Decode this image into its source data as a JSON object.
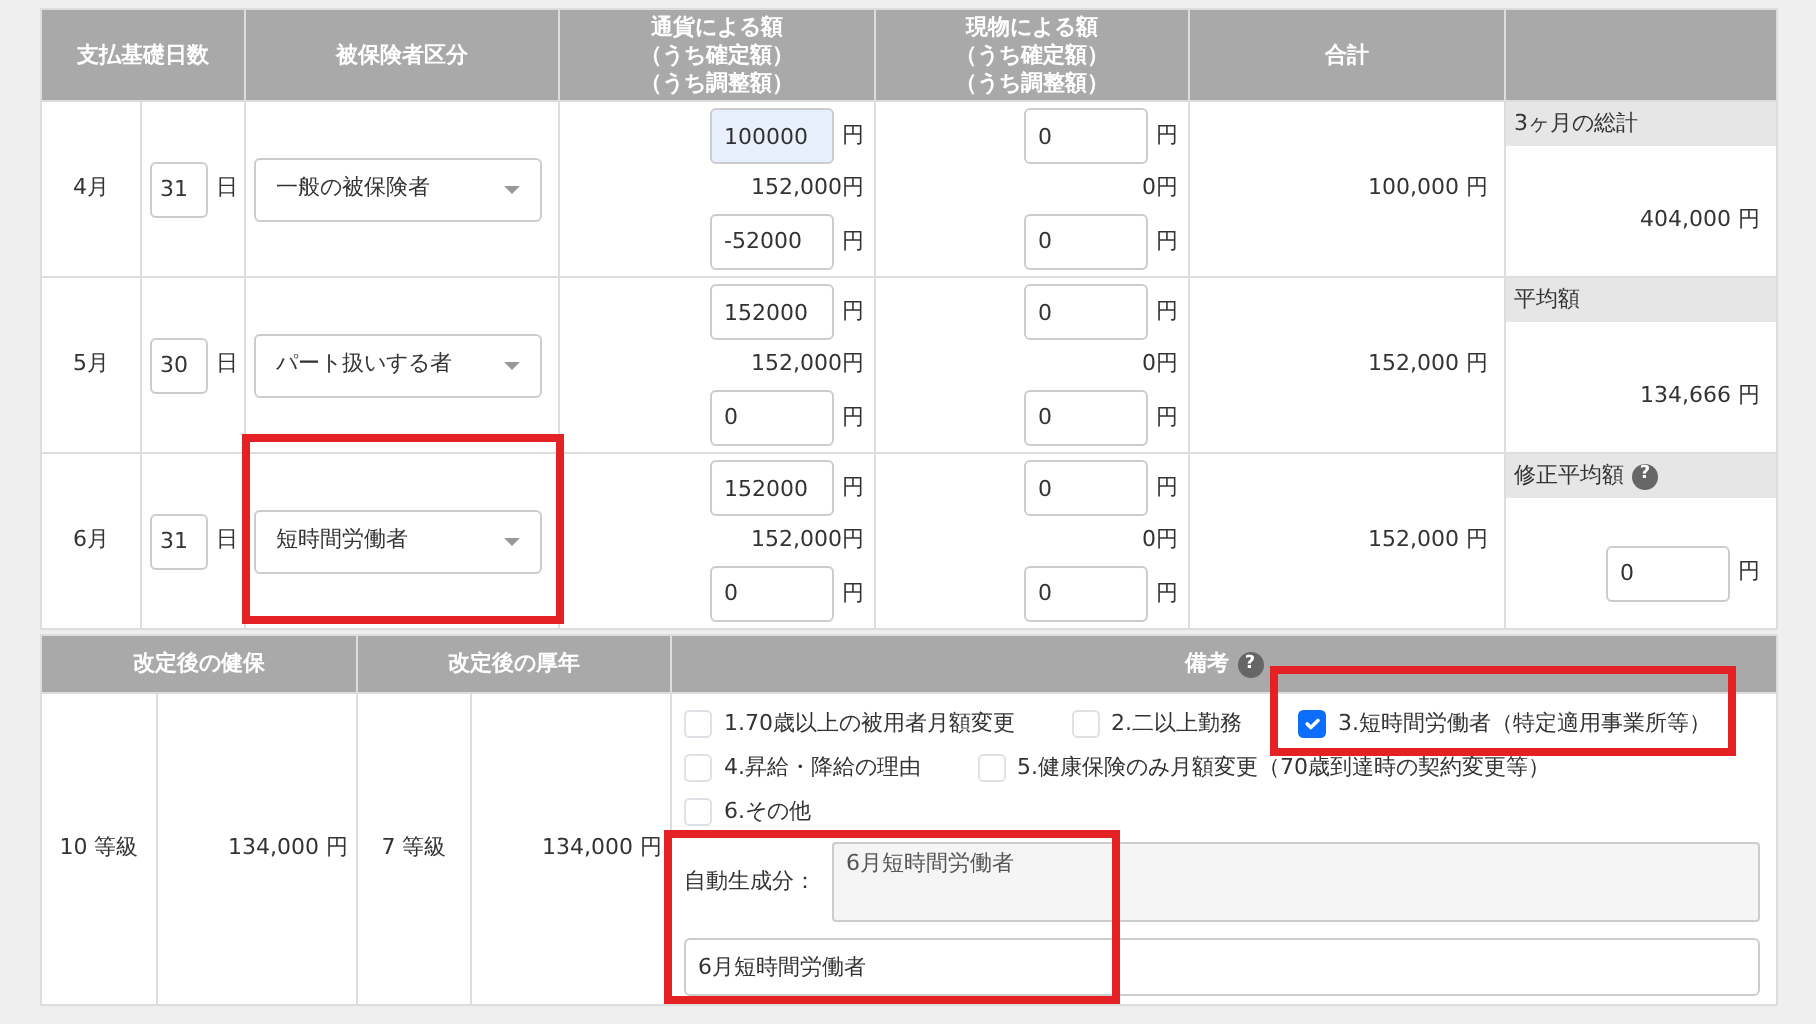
{
  "header": {
    "columns": [
      {
        "lines": [
          "支払基礎日数"
        ]
      },
      {
        "lines": [
          "被保険者区分"
        ]
      },
      {
        "lines": [
          "通貨による額",
          "（うち確定額）",
          "（うち調整額）"
        ]
      },
      {
        "lines": [
          "現物による額",
          "（うち確定額）",
          "（うち調整額）"
        ]
      },
      {
        "lines": [
          "合計"
        ]
      },
      {}
    ]
  },
  "rows": [
    {
      "month": "4月",
      "days": "31",
      "day_unit": "日",
      "insured_type": {
        "value": "一般の被保険者"
      },
      "cash": {
        "input": {
          "value": "100000",
          "unit": "円",
          "focused": true
        },
        "confirmed": "152,000円",
        "adjust": {
          "value": "-52000",
          "unit": "円",
          "focused": false
        }
      },
      "goods": {
        "input": {
          "value": "0",
          "unit": "円",
          "focused": false
        },
        "confirmed": "0円",
        "adjust": {
          "value": "0",
          "unit": "円",
          "focused": false
        }
      },
      "total": "100,000 円",
      "summary": {
        "kind": "text",
        "label": "3ヶ月の総計",
        "value": "404,000 円"
      }
    },
    {
      "month": "5月",
      "days": "30",
      "day_unit": "日",
      "insured_type": {
        "value": "パート扱いする者"
      },
      "cash": {
        "input": {
          "value": "152000",
          "unit": "円",
          "focused": false
        },
        "confirmed": "152,000円",
        "adjust": {
          "value": "0",
          "unit": "円",
          "focused": false
        }
      },
      "goods": {
        "input": {
          "value": "0",
          "unit": "円",
          "focused": false
        },
        "confirmed": "0円",
        "adjust": {
          "value": "0",
          "unit": "円",
          "focused": false
        }
      },
      "total": "152,000 円",
      "summary": {
        "kind": "text",
        "label": "平均額",
        "value": "134,666 円"
      }
    },
    {
      "month": "6月",
      "days": "31",
      "day_unit": "日",
      "insured_type": {
        "value": "短時間労働者",
        "highlighted": true
      },
      "cash": {
        "input": {
          "value": "152000",
          "unit": "円",
          "focused": false
        },
        "confirmed": "152,000円",
        "adjust": {
          "value": "0",
          "unit": "円",
          "focused": false
        }
      },
      "goods": {
        "input": {
          "value": "0",
          "unit": "円",
          "focused": false
        },
        "confirmed": "0円",
        "adjust": {
          "value": "0",
          "unit": "円",
          "focused": false
        }
      },
      "total": "152,000 円",
      "summary": {
        "kind": "input",
        "label": "修正平均額",
        "help": "?",
        "value": "0",
        "unit": "円"
      }
    }
  ],
  "revision": {
    "columns": [
      {
        "label": "改定後の健保"
      },
      {
        "label": "改定後の厚年"
      },
      {
        "label": "備考",
        "help": "?"
      }
    ],
    "health_grade": "10 等級",
    "health_amount": "134,000 円",
    "pension_grade": "7 等級",
    "pension_amount": "134,000 円",
    "remarks": {
      "checkbox_rows": [
        [
          {
            "label": "1.70歳以上の被用者月額変更",
            "checked": false
          },
          {
            "label": "2.二以上勤務",
            "checked": false
          },
          {
            "label": "3.短時間労働者（特定適用事業所等）",
            "checked": true,
            "highlighted": true
          }
        ],
        [
          {
            "label": "4.昇給・降給の理由",
            "checked": false
          },
          {
            "label": "5.健康保険のみ月額変更（70歳到達時の契約変更等）",
            "checked": false
          }
        ],
        [
          {
            "label": "6.その他",
            "checked": false
          }
        ]
      ],
      "auto_label": "自動生成分：",
      "auto_text": "6月短時間労働者",
      "note": "6月短時間労働者",
      "highlighted": true
    }
  }
}
